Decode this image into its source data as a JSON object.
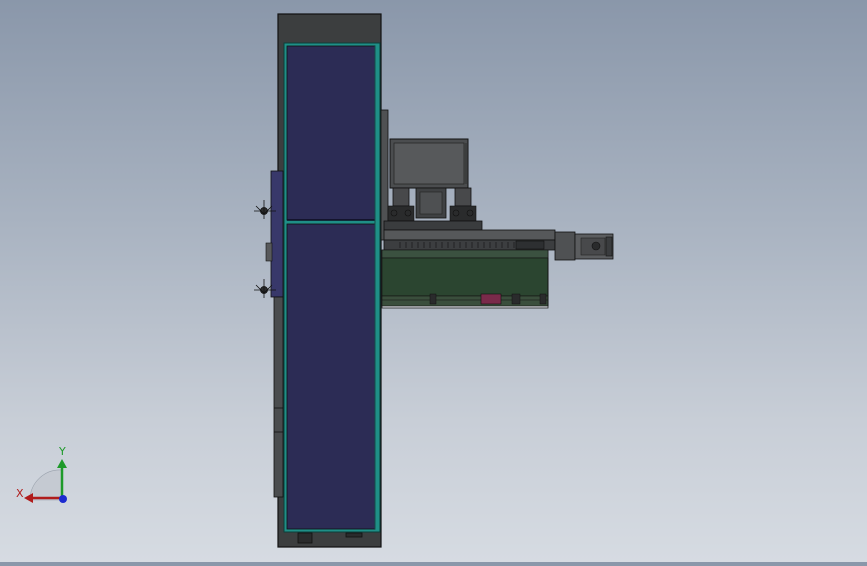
{
  "viewport": {
    "background_top": "#8a97aa",
    "background_bottom": "#d6dbe2"
  },
  "model": {
    "frame_color": "#3c3e3f",
    "panel_color": "#2c2c55",
    "trim_color": "#1f8f87",
    "machine_body_color": "#5a5c5e",
    "base_color": "#2b4530",
    "accent_color": "#7a2a4a"
  },
  "triad": {
    "x_label": "X",
    "y_label": "Y",
    "x_color": "#b01c1c",
    "y_color": "#1e9a2a",
    "z_color": "#1c2bd0"
  }
}
